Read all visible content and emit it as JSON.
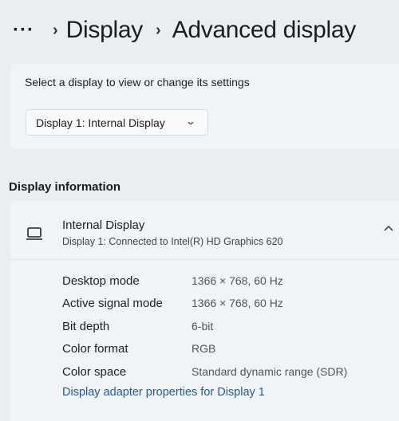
{
  "breadcrumb": {
    "more": "···",
    "items": [
      "Display",
      "Advanced display"
    ]
  },
  "selector": {
    "hint": "Select a display to view or change its settings",
    "selected": "Display 1: Internal Display"
  },
  "display_info": {
    "section_title": "Display information",
    "device_name": "Internal Display",
    "device_subtitle": "Display 1: Connected to Intel(R) HD Graphics 620",
    "properties": [
      {
        "label": "Desktop mode",
        "value": "1366 × 768, 60 Hz"
      },
      {
        "label": "Active signal mode",
        "value": "1366 × 768, 60 Hz"
      },
      {
        "label": "Bit depth",
        "value": "6-bit"
      },
      {
        "label": "Color format",
        "value": "RGB"
      },
      {
        "label": "Color space",
        "value": "Standard dynamic range (SDR)"
      }
    ],
    "adapter_link": "Display adapter properties for Display 1"
  },
  "icons": {
    "device": "laptop-icon",
    "collapse": "chevron-up-icon",
    "dropdown": "chevron-down-icon"
  },
  "colors": {
    "background": "#e9eef1",
    "card": "#f1f4f6",
    "link": "#2a5a8e"
  }
}
